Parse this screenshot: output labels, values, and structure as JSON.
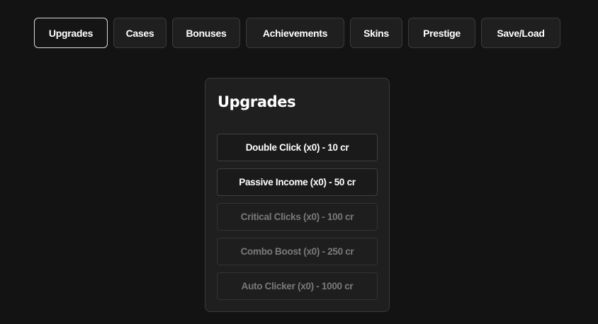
{
  "tabs": [
    {
      "label": "Upgrades",
      "active": true
    },
    {
      "label": "Cases",
      "active": false
    },
    {
      "label": "Bonuses",
      "active": false
    },
    {
      "label": "Achievements",
      "active": false
    },
    {
      "label": "Skins",
      "active": false
    },
    {
      "label": "Prestige",
      "active": false
    },
    {
      "label": "Save/Load",
      "active": false
    }
  ],
  "panel": {
    "title": "Upgrades",
    "upgrades": [
      {
        "label": "Double Click (x0) - 10 cr",
        "enabled": true
      },
      {
        "label": "Passive Income (x0) - 50 cr",
        "enabled": true
      },
      {
        "label": "Critical Clicks (x0) - 100 cr",
        "enabled": false
      },
      {
        "label": "Combo Boost (x0) - 250 cr",
        "enabled": false
      },
      {
        "label": "Auto Clicker (x0) - 1000 cr",
        "enabled": false
      }
    ]
  },
  "colors": {
    "background": "#131313",
    "panel": "#1f1f1f",
    "border": "#3a3a3a",
    "active_border": "#d9d9d9",
    "disabled_text": "#7a7a7a"
  }
}
